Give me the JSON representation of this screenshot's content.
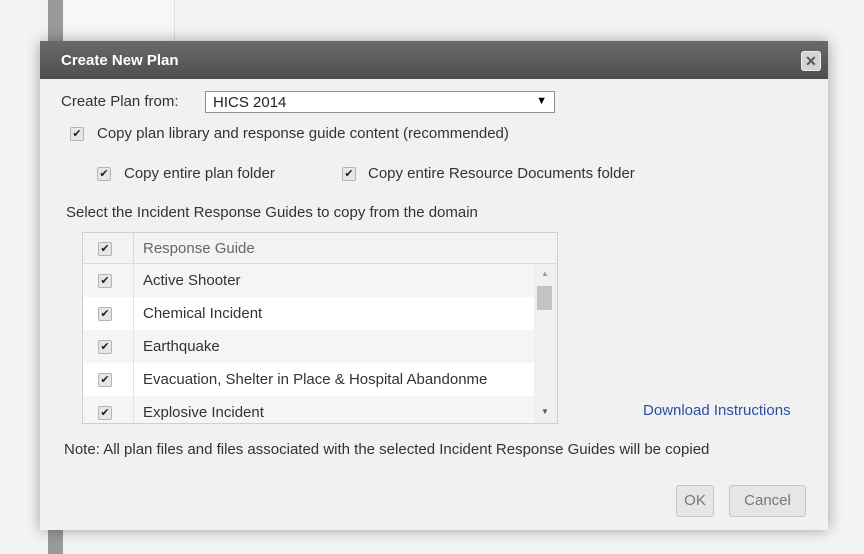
{
  "dialog": {
    "title": "Create New Plan",
    "close_symbol": "✕",
    "create_from_label": "Create Plan from:",
    "create_from_value": "HICS 2014",
    "select_arrow": "▼",
    "check_symbol": "✔",
    "copy_library_label": "Copy plan library and response guide content (recommended)",
    "copy_plan_folder_label": "Copy entire plan folder",
    "copy_resource_docs_label": "Copy entire Resource Documents folder",
    "select_guides_label": "Select the Incident Response Guides to copy from the domain",
    "grid": {
      "column_header": "Response Guide",
      "rows": [
        {
          "label": "Active Shooter",
          "checked": true
        },
        {
          "label": "Chemical Incident",
          "checked": true
        },
        {
          "label": "Earthquake",
          "checked": true
        },
        {
          "label": "Evacuation, Shelter in Place & Hospital Abandonme",
          "checked": true
        },
        {
          "label": "Explosive Incident",
          "checked": true
        }
      ],
      "scroll_up_symbol": "▲",
      "scroll_down_symbol": "▼"
    },
    "download_link": "Download Instructions",
    "note": "Note: All plan files and files associated with the selected Incident Response Guides will be copied",
    "ok_label": "OK",
    "cancel_label": "Cancel"
  },
  "colors": {
    "titlebar": "#555555",
    "link": "#2a4fa8",
    "selected_row": "#ffffff"
  }
}
